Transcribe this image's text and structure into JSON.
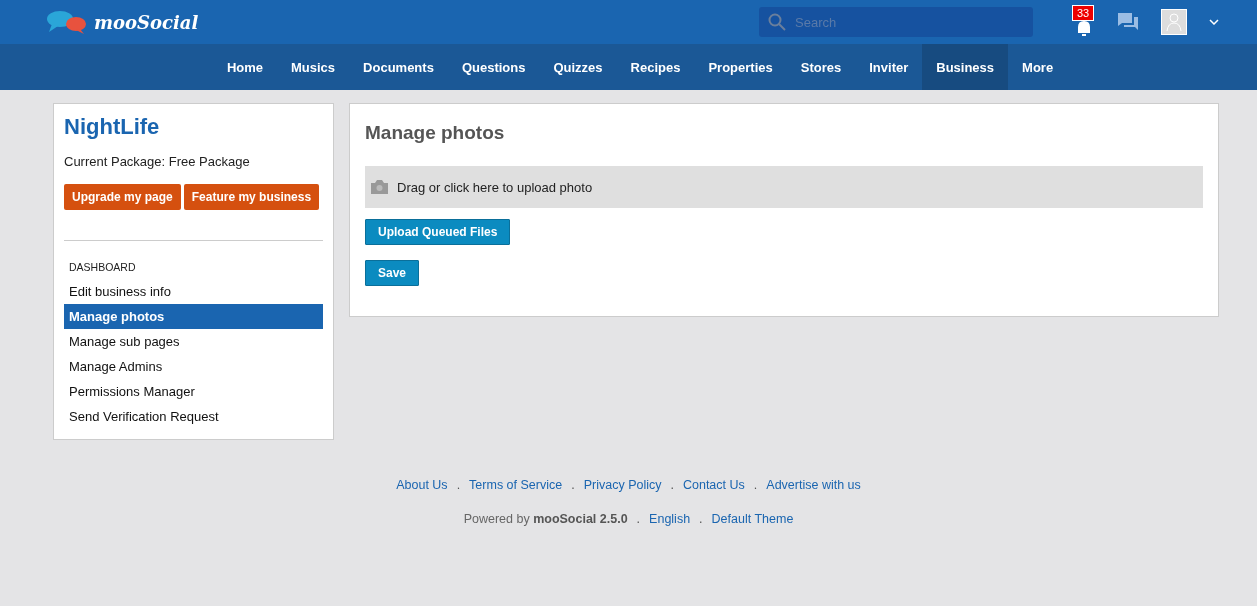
{
  "header": {
    "logo": "mooSocial",
    "search": {
      "placeholder": "Search"
    },
    "notifications": {
      "count": "33"
    }
  },
  "nav": [
    {
      "label": "Home",
      "selected": false
    },
    {
      "label": "Musics",
      "selected": false
    },
    {
      "label": "Documents",
      "selected": false
    },
    {
      "label": "Questions",
      "selected": false
    },
    {
      "label": "Quizzes",
      "selected": false
    },
    {
      "label": "Recipes",
      "selected": false
    },
    {
      "label": "Properties",
      "selected": false
    },
    {
      "label": "Stores",
      "selected": false
    },
    {
      "label": "Inviter",
      "selected": false
    },
    {
      "label": "Business",
      "selected": true
    },
    {
      "label": "More",
      "selected": false
    }
  ],
  "sidebar": {
    "title": "NightLife",
    "package": "Current Package: Free Package",
    "buttons": [
      "Upgrade my page",
      "Feature my business"
    ],
    "section": "DASHBOARD",
    "items": [
      {
        "label": "Edit business info",
        "selected": false
      },
      {
        "label": "Manage photos",
        "selected": true
      },
      {
        "label": "Manage sub pages",
        "selected": false
      },
      {
        "label": "Manage Admins",
        "selected": false
      },
      {
        "label": "Permissions Manager",
        "selected": false
      },
      {
        "label": "Send Verification Request",
        "selected": false
      }
    ]
  },
  "main": {
    "title": "Manage photos",
    "dropzone": "Drag or click here to upload photo",
    "buttons": [
      "Upload Queued Files",
      "Save"
    ]
  },
  "footer": {
    "links": [
      "About Us",
      "Terms of Service",
      "Privacy Policy",
      "Contact Us",
      "Advertise with us"
    ],
    "separator": ".",
    "powered": "Powered by **mooSocial 2.5.0**",
    "meta_links": [
      "English",
      "Default Theme"
    ]
  }
}
